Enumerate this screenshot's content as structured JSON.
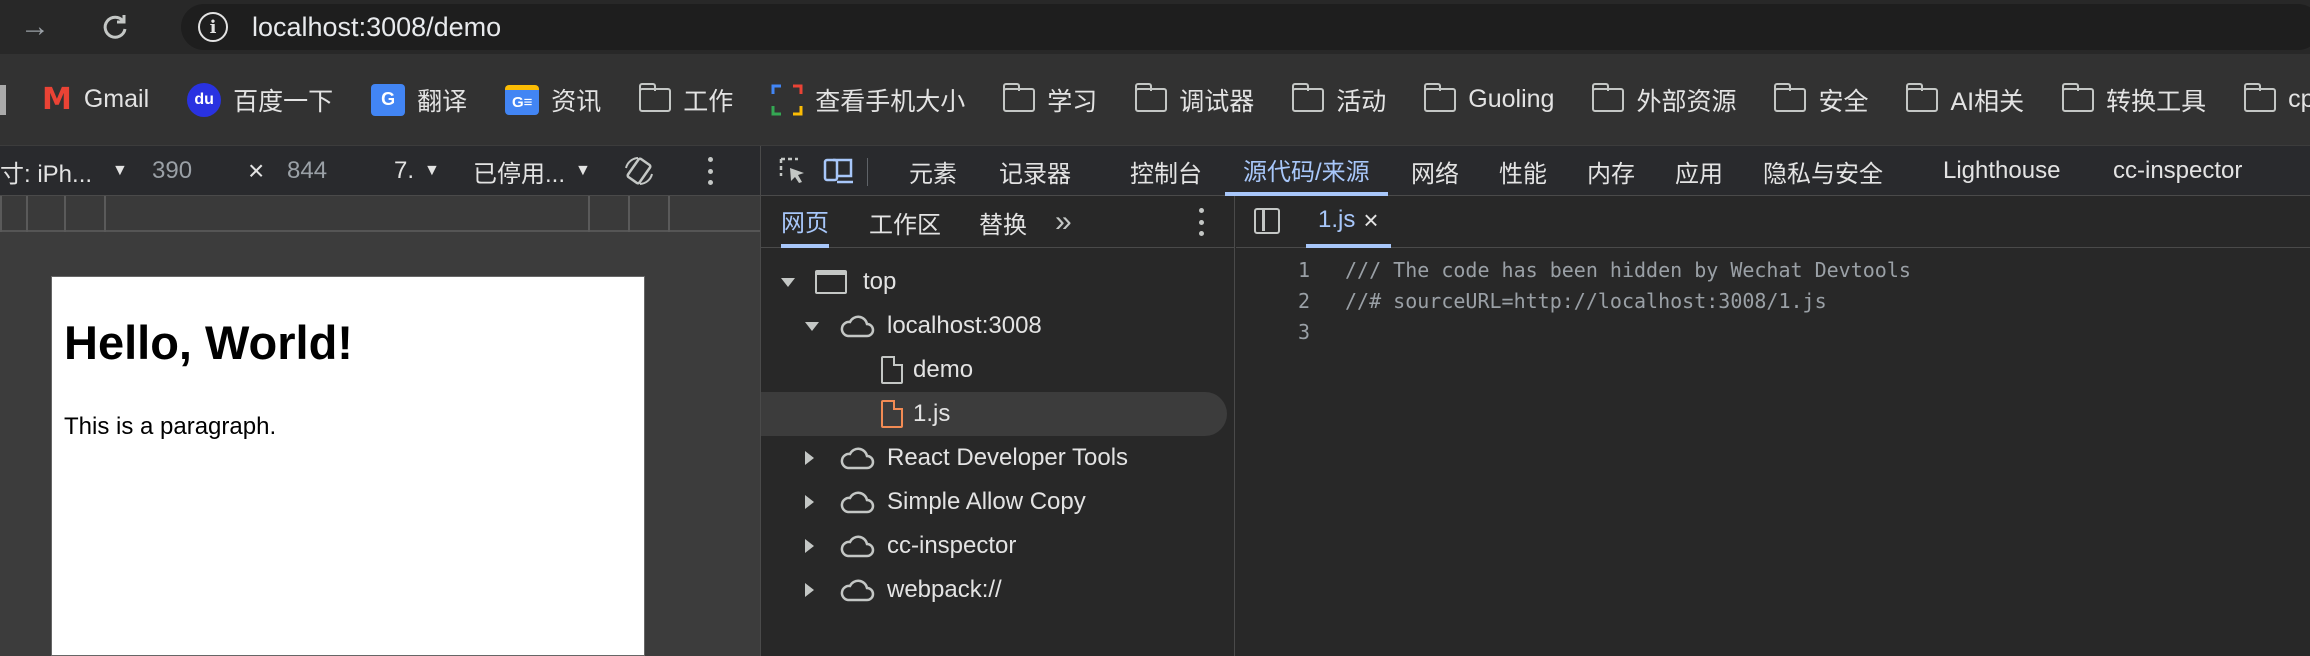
{
  "browser": {
    "url": "localhost:3008/demo"
  },
  "bookmarks": [
    {
      "label": "Gmail",
      "icon": "gmail-icon"
    },
    {
      "label": "百度一下",
      "icon": "baidu-icon"
    },
    {
      "label": "翻译",
      "icon": "google-translate-icon"
    },
    {
      "label": "资讯",
      "icon": "google-news-icon"
    },
    {
      "label": "工作",
      "icon": "folder-icon"
    },
    {
      "label": "查看手机大小",
      "icon": "measure-icon"
    },
    {
      "label": "学习",
      "icon": "folder-icon"
    },
    {
      "label": "调试器",
      "icon": "folder-icon"
    },
    {
      "label": "活动",
      "icon": "folder-icon"
    },
    {
      "label": "Guoling",
      "icon": "folder-icon"
    },
    {
      "label": "外部资源",
      "icon": "folder-icon"
    },
    {
      "label": "安全",
      "icon": "folder-icon"
    },
    {
      "label": "AI相关",
      "icon": "folder-icon"
    },
    {
      "label": "转换工具",
      "icon": "folder-icon"
    },
    {
      "label": "cpol",
      "icon": "folder-icon"
    }
  ],
  "device_toolbar": {
    "device": "寸: iPh...",
    "width": "390",
    "times": "×",
    "height": "844",
    "zoom": "7.",
    "throttle": "已停用..."
  },
  "viewport_page": {
    "heading": "Hello, World!",
    "paragraph": "This is a paragraph."
  },
  "devtools": {
    "tabs": [
      "元素",
      "记录器",
      "控制台",
      "源代码/来源",
      "网络",
      "性能",
      "内存",
      "应用",
      "隐私与安全",
      "Lighthouse",
      "cc-inspector"
    ],
    "active_tab": "源代码/来源",
    "navigator_tabs": [
      "网页",
      "工作区",
      "替换"
    ],
    "navigator_more": "»",
    "tree": [
      {
        "label": "top",
        "depth": 0,
        "expanded": true,
        "icon": "frame-icon"
      },
      {
        "label": "localhost:3008",
        "depth": 1,
        "expanded": true,
        "icon": "cloud-icon"
      },
      {
        "label": "demo",
        "depth": 2,
        "icon": "file-icon"
      },
      {
        "label": "1.js",
        "depth": 2,
        "icon": "file-js-icon",
        "selected": true
      },
      {
        "label": "React Developer Tools",
        "depth": 1,
        "expanded": false,
        "icon": "cloud-icon"
      },
      {
        "label": "Simple Allow Copy",
        "depth": 1,
        "expanded": false,
        "icon": "cloud-icon"
      },
      {
        "label": "cc-inspector",
        "depth": 1,
        "expanded": false,
        "icon": "cloud-icon"
      },
      {
        "label": "webpack://",
        "depth": 1,
        "expanded": false,
        "icon": "cloud-icon"
      }
    ],
    "editor": {
      "open_file": "1.js",
      "close": "×",
      "lines": [
        {
          "n": "1",
          "text": "/// The code has been hidden by Wechat Devtools"
        },
        {
          "n": "2",
          "text": "//# sourceURL=http://localhost:3008/1.js"
        },
        {
          "n": "3",
          "text": ""
        }
      ]
    }
  },
  "colors": {
    "accent": "#a8c7fa",
    "js_file": "#f28b54"
  }
}
